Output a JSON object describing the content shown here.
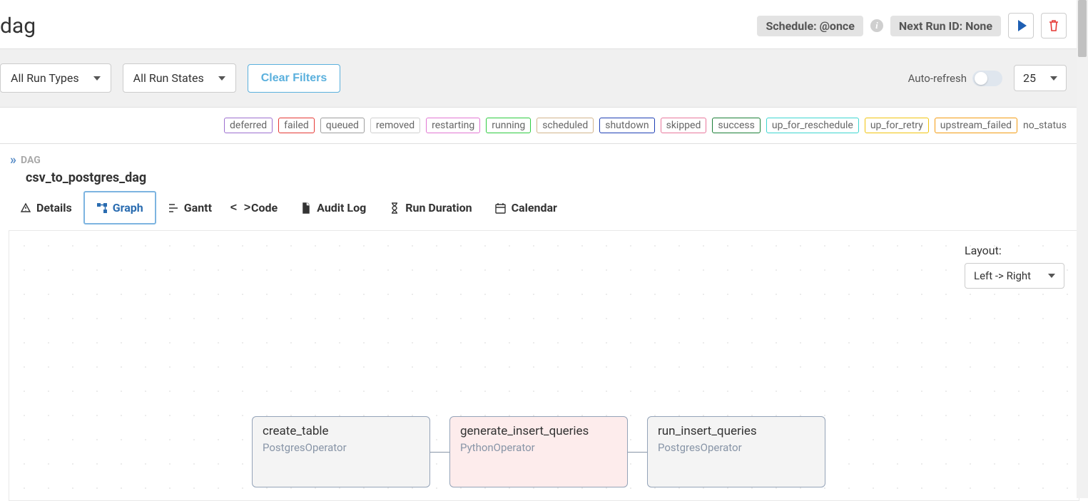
{
  "header": {
    "title_fragment": "dag",
    "schedule_label": "Schedule: @once",
    "next_run_label": "Next Run ID: None"
  },
  "filters": {
    "run_types": "All Run Types",
    "run_states": "All Run States",
    "clear": "Clear Filters",
    "auto_refresh": "Auto-refresh",
    "count": "25"
  },
  "legend": [
    {
      "label": "deferred",
      "color": "#9d6fcf"
    },
    {
      "label": "failed",
      "color": "#e53935"
    },
    {
      "label": "queued",
      "color": "#9e9e9e"
    },
    {
      "label": "removed",
      "color": "#d0d0d0"
    },
    {
      "label": "restarting",
      "color": "#e277d3"
    },
    {
      "label": "running",
      "color": "#2ecc40"
    },
    {
      "label": "scheduled",
      "color": "#d2b48c"
    },
    {
      "label": "shutdown",
      "color": "#1e3fb5"
    },
    {
      "label": "skipped",
      "color": "#e8789d"
    },
    {
      "label": "success",
      "color": "#1a7f37"
    },
    {
      "label": "up_for_reschedule",
      "color": "#3dd6d0"
    },
    {
      "label": "up_for_retry",
      "color": "#f1c40f"
    },
    {
      "label": "upstream_failed",
      "color": "#f39c12"
    }
  ],
  "legend_plain": "no_status",
  "breadcrumb": {
    "label": "DAG"
  },
  "dag_name": "csv_to_postgres_dag",
  "tabs": {
    "details": "Details",
    "graph": "Graph",
    "gantt": "Gantt",
    "code": "Code",
    "audit": "Audit Log",
    "duration": "Run Duration",
    "calendar": "Calendar"
  },
  "layout": {
    "label": "Layout:",
    "value": "Left -> Right"
  },
  "nodes": [
    {
      "task": "create_table",
      "op": "PostgresOperator",
      "bg": "plain"
    },
    {
      "task": "generate_insert_queries",
      "op": "PythonOperator",
      "bg": "mid"
    },
    {
      "task": "run_insert_queries",
      "op": "PostgresOperator",
      "bg": "plain"
    }
  ]
}
